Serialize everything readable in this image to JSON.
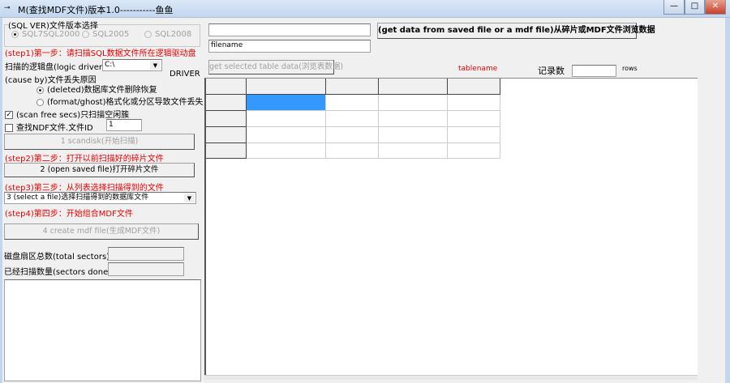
{
  "window": {
    "title": "M(查找MDF文件)版本1.0-----------鱼鱼",
    "min": "—",
    "max": "□",
    "close": "✕"
  },
  "left": {
    "group_title": "(SQL VER)文件版本选择",
    "sql_versions": [
      "SQL7SQL2000",
      "SQL2005",
      "SQL2008"
    ],
    "step1": "(step1)第一步：请扫描SQL数据文件所在逻辑驱动盘",
    "driver_label": "扫描的逻辑盘(logic driver)",
    "driver_value": "C:\\",
    "driver_caption": "DRIVER",
    "cause_label": "(cause by)文件丢失原因",
    "cause_options": [
      "(deleted)数据库文件删除恢复",
      "(format/ghost)格式化或分区导致文件丢失"
    ],
    "scan_free": "(scan free secs)只扫描空闲簇",
    "find_ndf": "查找NDF文件.文件ID",
    "ndf_id": "1",
    "btn_scan": "1 scandisk(开始扫描)",
    "step2": "(step2)第二步：打开以前扫描好的碎片文件",
    "btn_open": "2 (open saved file)打开碎片文件",
    "step3": "(step3)第三步：从列表选择扫描得到的文件",
    "select_file": "3 (select a file)选择扫描得到的数据库文件",
    "step4": "(step4)第四步：开始组合MDF文件",
    "btn_create": "4 create mdf file(生成MDF文件)",
    "total_sectors": "磁盘扇区总数(total sectors)",
    "sectors_done": "已经扫描数量(sectors done)"
  },
  "right": {
    "path_value": "",
    "filename": "filename",
    "btn_get_data": "(get data from saved file or a mdf file)从碎片或MDF文件浏览数据",
    "btn_table_data": "get selected table data(浏览表数据)",
    "tablename": "tablename",
    "record_label": "记录数",
    "rows_label": "rows"
  },
  "colors": {
    "accent": "#3399ff",
    "red": "#e00000"
  }
}
